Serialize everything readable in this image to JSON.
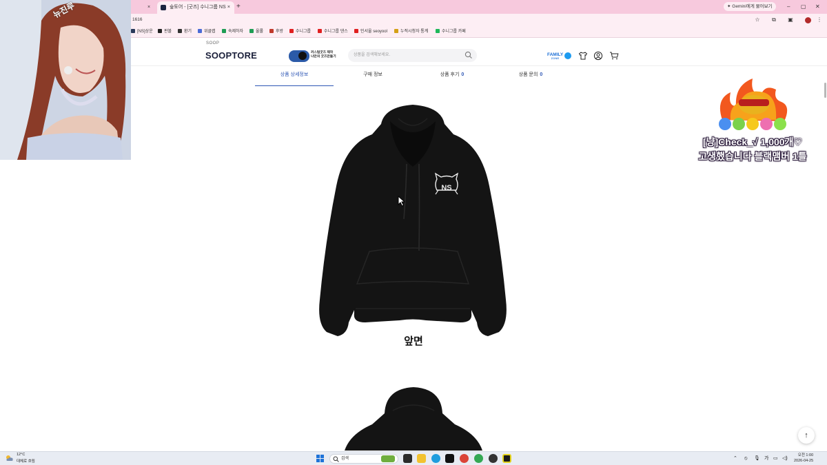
{
  "browser": {
    "inactive_tab_close": "×",
    "active_tab": {
      "title": "숲토어 - [굿즈] 수니그룹 NS ",
      "close": "×"
    },
    "new_tab": "+",
    "gemini_button": "Gemini에게 물어보기",
    "window_controls": [
      "–",
      "▢",
      "✕"
    ],
    "address_url": "1616",
    "bookmarks": [
      {
        "label": "[NS]상운",
        "color": "#2a3a5a"
      },
      {
        "label": "판볼",
        "color": "#222222"
      },
      {
        "label": "환기",
        "color": "#333333"
      },
      {
        "label": "위클랩",
        "color": "#4b6bd6"
      },
      {
        "label": "숙제하자",
        "color": "#1f9d55"
      },
      {
        "label": "울롤",
        "color": "#1f9d55"
      },
      {
        "label": "후방",
        "color": "#c0392b"
      },
      {
        "label": "수니그룹",
        "color": "#e02020"
      },
      {
        "label": "수니그룹 댄스",
        "color": "#e02020"
      },
      {
        "label": "인서울 seoyool",
        "color": "#e02020"
      },
      {
        "label": "누적시청자 통계",
        "color": "#d4a017"
      },
      {
        "label": "수니그룹 카페",
        "color": "#1fb85a"
      }
    ]
  },
  "header": {
    "brand_sub": "SOOP",
    "brand": "SOOPTORE",
    "promo_lines": [
      "커스텀굿즈 제작",
      "나만의 굿즈만들기"
    ],
    "search_placeholder": "상품을 검색해보세요.",
    "family_label": "FAMILY",
    "family_sub": "ZONE"
  },
  "product_tabs": [
    {
      "label": "상품 상세정보",
      "count": ""
    },
    {
      "label": "구매 정보",
      "count": ""
    },
    {
      "label": "상품 후기",
      "count": "0"
    },
    {
      "label": "상품 문의",
      "count": "0"
    }
  ],
  "product": {
    "front_caption": "앞면",
    "logo_text": "NS"
  },
  "overlay": {
    "webcam_sticker": "뉴진루",
    "alert_lines": [
      "[냥]Check_√ 1,000개♡",
      "고생했습니다 블랙맴버 1틀"
    ]
  },
  "taskbar": {
    "weather_temp": "12°C",
    "weather_desc": "대체로 흐림",
    "search_placeholder": "검색",
    "ime": "가",
    "clock_time": "오전 1:00",
    "clock_date": "2026-04-25"
  },
  "scroll_top": "↑",
  "colors": {
    "accent": "#2c55b5",
    "tab_bg": "#f7c9dd",
    "chrome_bg": "#fdeef4",
    "brand": "#1a1f3a"
  }
}
